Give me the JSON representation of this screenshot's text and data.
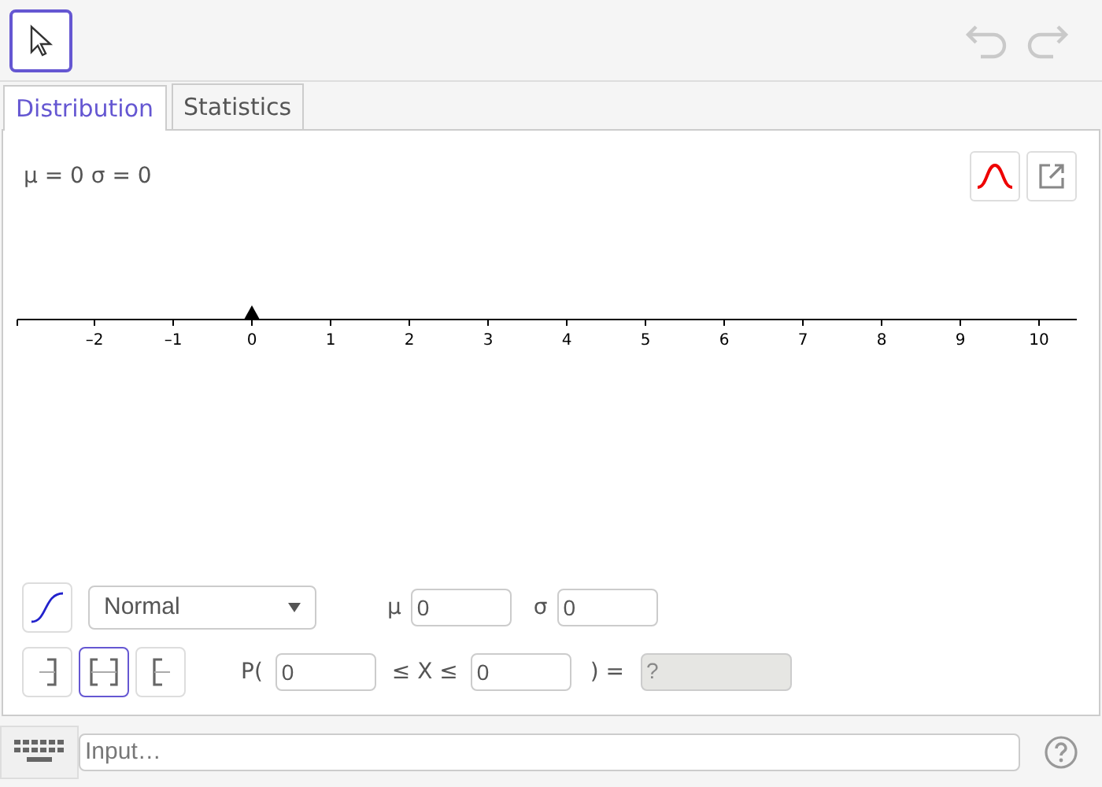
{
  "toolbar": {
    "tools": [
      {
        "kind": "pointer",
        "selected": true
      }
    ],
    "undo": {
      "disabled": true
    },
    "redo": {
      "disabled": true
    }
  },
  "tabs": [
    {
      "label": "Distribution",
      "selected": true
    },
    {
      "label": "Statistics",
      "selected": false
    }
  ],
  "summary": "μ = 0 σ = 0",
  "axis": {
    "ticks": [
      {
        "label": "–2",
        "marked": false
      },
      {
        "label": "–1",
        "marked": false
      },
      {
        "label": "0",
        "marked": true
      },
      {
        "label": "1",
        "marked": false
      },
      {
        "label": "2",
        "marked": false
      },
      {
        "label": "3",
        "marked": false
      },
      {
        "label": "4",
        "marked": false
      },
      {
        "label": "5",
        "marked": false
      },
      {
        "label": "6",
        "marked": false
      },
      {
        "label": "7",
        "marked": false
      },
      {
        "label": "8",
        "marked": false
      },
      {
        "label": "9",
        "marked": false
      },
      {
        "label": "10",
        "marked": false
      }
    ]
  },
  "distribution": {
    "cumulative": false,
    "type": "Normal",
    "params": [
      {
        "label": "μ",
        "value": "0"
      },
      {
        "label": "σ",
        "value": "0"
      }
    ]
  },
  "interval": {
    "modes": [
      {
        "kind": "left",
        "selected": false
      },
      {
        "kind": "two-sided",
        "selected": true
      },
      {
        "kind": "right",
        "selected": false
      }
    ],
    "prefix": "P(",
    "low": "0",
    "middle": "≤ X ≤",
    "high": "0",
    "equals": ") =",
    "result": "?"
  },
  "input_bar": {
    "placeholder": "Input…"
  }
}
